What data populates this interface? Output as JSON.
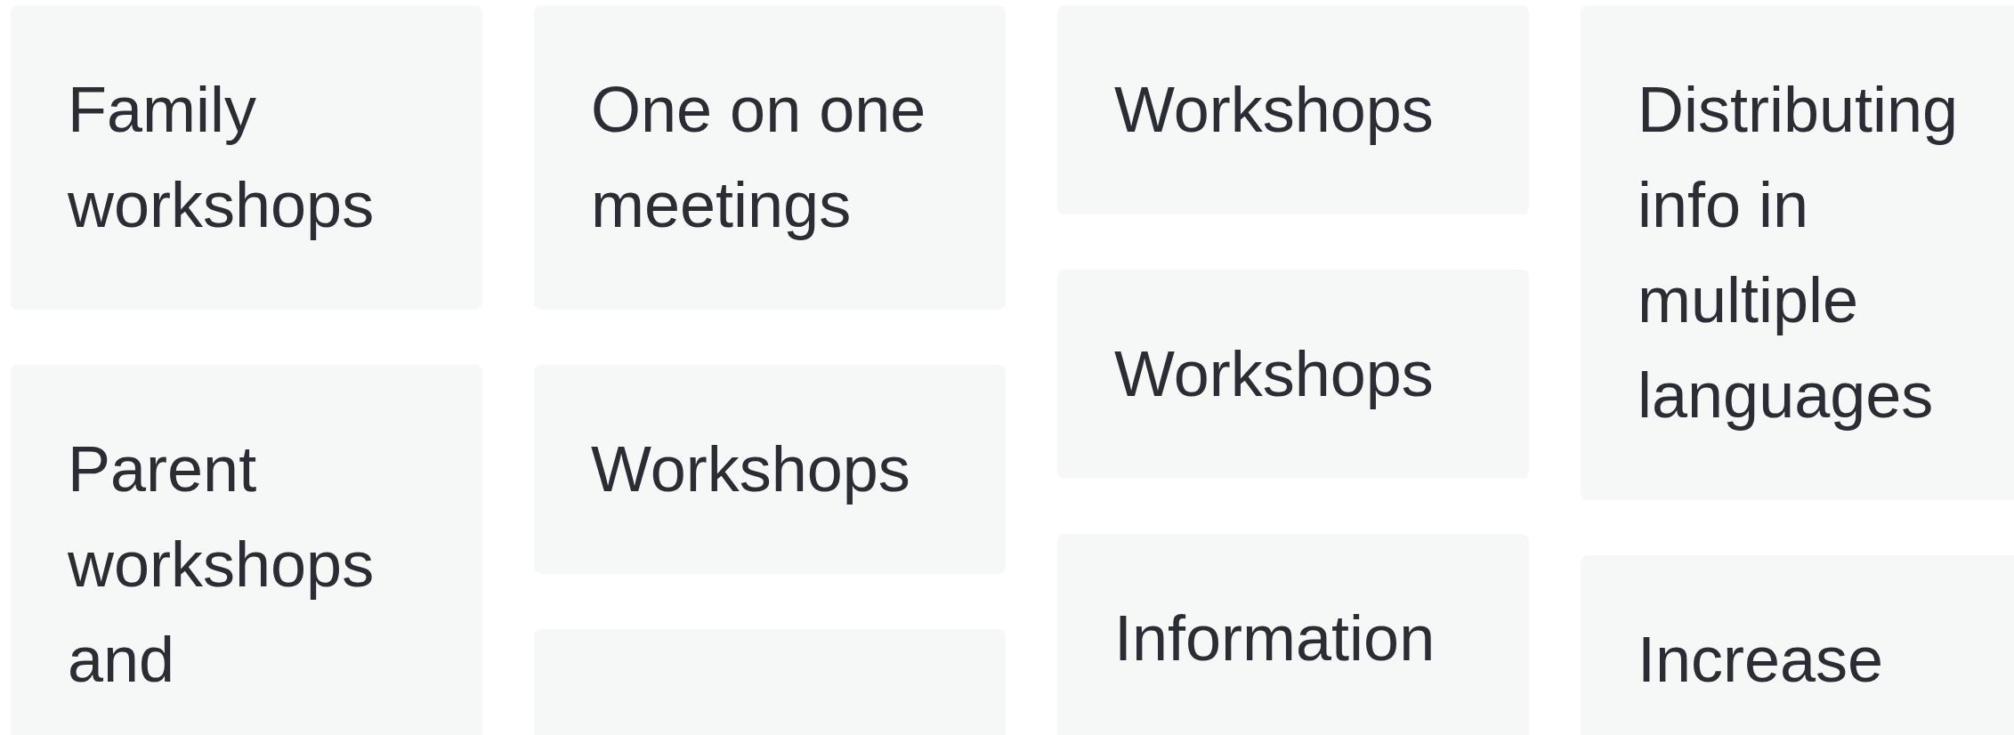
{
  "columns": [
    {
      "cards": [
        {
          "kind": "text",
          "text": "Family workshops"
        },
        {
          "kind": "text",
          "text": "Parent workshops and"
        }
      ]
    },
    {
      "cards": [
        {
          "kind": "text",
          "text": "One on one meetings"
        },
        {
          "kind": "text",
          "text": "Workshops"
        },
        {
          "kind": "blank"
        }
      ]
    },
    {
      "cards": [
        {
          "kind": "text",
          "text": "Workshops"
        },
        {
          "kind": "text",
          "text": "Workshops"
        },
        {
          "kind": "text",
          "text": "Information"
        }
      ]
    },
    {
      "cards": [
        {
          "kind": "text",
          "text": "Distributing info in multiple languages"
        },
        {
          "kind": "text",
          "text": "Increase"
        }
      ]
    }
  ]
}
